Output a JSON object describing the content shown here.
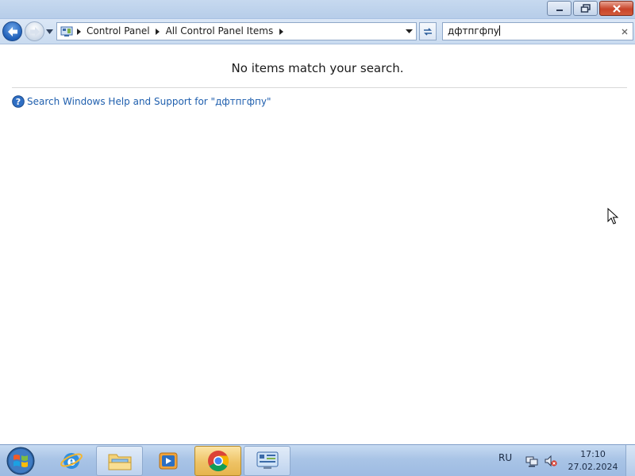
{
  "window": {
    "minimize_label": "Minimize",
    "maximize_label": "Restore",
    "close_label": "Close"
  },
  "navbar": {
    "breadcrumbs": [
      "Control Panel",
      "All Control Panel Items"
    ],
    "search": {
      "value": "дфтпгфпу"
    }
  },
  "content": {
    "message": "No items match your search.",
    "help_link": "Search Windows Help and Support for \"дфтпгфпу\""
  },
  "taskbar": {
    "apps": [
      {
        "icon": "internet-explorer-icon"
      },
      {
        "icon": "file-explorer-icon"
      },
      {
        "icon": "media-player-icon"
      },
      {
        "icon": "chrome-icon"
      },
      {
        "icon": "control-panel-icon"
      }
    ],
    "language": "RU",
    "clock_time": "17:10",
    "clock_date": "27.02.2024"
  },
  "colors": {
    "link": "#1f5fae",
    "close_button": "#c8442a",
    "active_task": "#eec366"
  }
}
